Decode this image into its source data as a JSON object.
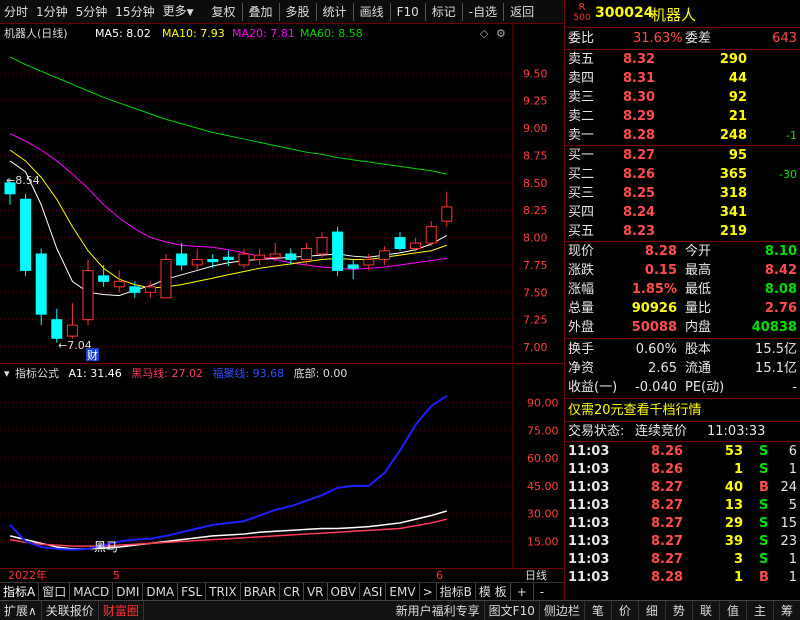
{
  "toolbar": {
    "left_items": [
      "分时",
      "1分钟",
      "5分钟",
      "15分钟",
      "更多"
    ],
    "right_items": [
      "复权",
      "叠加",
      "多股",
      "统计",
      "画线",
      "F10",
      "标记",
      "-自选",
      "返回"
    ]
  },
  "symbol": {
    "badge_top": "R",
    "badge_bottom": "500",
    "code": "300024",
    "name": "机器人"
  },
  "main_legend": {
    "title": "机器人(日线)",
    "ma5": "MA5: 8.02",
    "ma10": "MA10: 7.93",
    "ma20": "MA20: 7.81",
    "ma60": "MA60: 8.58",
    "high_label": "8.54",
    "low_label": "7.04",
    "marker": "财"
  },
  "ind_legend": {
    "name": "指标公式",
    "a1": "A1: 31.46",
    "heima": "黑马线: 27.02",
    "zhuli": "福聚线: 93.68",
    "dibu": "底部: 0.00",
    "curve_label": "黑马"
  },
  "colors": {
    "up": "#ff3232",
    "down": "#00ffff",
    "ma5": "#ffffff",
    "ma10": "#ffff00",
    "ma20": "#ff00ff",
    "ma60": "#00d400",
    "zhuli": "#1e1eff",
    "heima": "#ff3c5a"
  },
  "chart_data": [
    {
      "type": "candlestick",
      "title": "机器人(日线)",
      "ylim": [
        6.9,
        9.75
      ],
      "yticks": [
        "9.50",
        "9.25",
        "9.00",
        "8.75",
        "8.50",
        "8.25",
        "8.00",
        "7.75",
        "7.50",
        "7.25",
        "7.00"
      ],
      "candles": [
        [
          8.5,
          8.54,
          8.3,
          8.4
        ],
        [
          8.35,
          8.4,
          7.65,
          7.7
        ],
        [
          7.85,
          7.9,
          7.2,
          7.3
        ],
        [
          7.25,
          7.35,
          7.04,
          7.08
        ],
        [
          7.1,
          7.4,
          7.08,
          7.2
        ],
        [
          7.25,
          7.8,
          7.2,
          7.7
        ],
        [
          7.65,
          7.75,
          7.55,
          7.6
        ],
        [
          7.55,
          7.7,
          7.5,
          7.6
        ],
        [
          7.55,
          7.6,
          7.45,
          7.5
        ],
        [
          7.5,
          7.6,
          7.45,
          7.55
        ],
        [
          7.45,
          7.85,
          7.45,
          7.8
        ],
        [
          7.85,
          7.95,
          7.7,
          7.75
        ],
        [
          7.75,
          7.9,
          7.7,
          7.8
        ],
        [
          7.8,
          7.85,
          7.72,
          7.78
        ],
        [
          7.82,
          7.88,
          7.74,
          7.8
        ],
        [
          7.75,
          7.9,
          7.72,
          7.85
        ],
        [
          7.8,
          7.9,
          7.75,
          7.84
        ],
        [
          7.82,
          7.95,
          7.78,
          7.85
        ],
        [
          7.85,
          7.9,
          7.75,
          7.8
        ],
        [
          7.8,
          7.95,
          7.75,
          7.9
        ],
        [
          7.85,
          8.05,
          7.82,
          8.0
        ],
        [
          8.05,
          8.1,
          7.65,
          7.7
        ],
        [
          7.75,
          7.8,
          7.62,
          7.72
        ],
        [
          7.75,
          7.85,
          7.7,
          7.8
        ],
        [
          7.8,
          7.92,
          7.75,
          7.88
        ],
        [
          8.0,
          8.05,
          7.88,
          7.9
        ],
        [
          7.9,
          8.0,
          7.85,
          7.95
        ],
        [
          7.95,
          8.15,
          7.92,
          8.1
        ],
        [
          8.15,
          8.42,
          8.1,
          8.28
        ]
      ],
      "ma5": [
        8.7,
        8.6,
        8.3,
        7.9,
        7.6,
        7.5,
        7.48,
        7.47,
        7.52,
        7.56,
        7.62,
        7.66,
        7.7,
        7.74,
        7.77,
        7.79,
        7.8,
        7.81,
        7.82,
        7.83,
        7.84,
        7.85,
        7.83,
        7.82,
        7.84,
        7.86,
        7.89,
        7.94,
        8.02
      ],
      "ma10": [
        8.8,
        8.7,
        8.55,
        8.35,
        8.1,
        7.88,
        7.72,
        7.62,
        7.57,
        7.54,
        7.55,
        7.57,
        7.6,
        7.63,
        7.66,
        7.69,
        7.72,
        7.74,
        7.76,
        7.78,
        7.8,
        7.81,
        7.8,
        7.8,
        7.82,
        7.84,
        7.86,
        7.88,
        7.93
      ],
      "ma20": [
        8.95,
        8.88,
        8.8,
        8.7,
        8.58,
        8.45,
        8.3,
        8.18,
        8.08,
        8.0,
        7.96,
        7.93,
        7.92,
        7.91,
        7.89,
        7.86,
        7.83,
        7.8,
        7.77,
        7.75,
        7.73,
        7.72,
        7.71,
        7.72,
        7.73,
        7.75,
        7.77,
        7.79,
        7.81
      ],
      "ma60": [
        9.65,
        9.58,
        9.52,
        9.46,
        9.4,
        9.34,
        9.28,
        9.23,
        9.18,
        9.13,
        9.08,
        9.04,
        9.0,
        8.96,
        8.93,
        8.9,
        8.87,
        8.84,
        8.81,
        8.78,
        8.76,
        8.73,
        8.71,
        8.69,
        8.67,
        8.65,
        8.63,
        8.61,
        8.58
      ]
    },
    {
      "type": "line",
      "ylim": [
        5,
        100
      ],
      "yticks": [
        "90.00",
        "75.00",
        "60.00",
        "45.00",
        "30.00",
        "15.00"
      ],
      "series": [
        {
          "name": "A1",
          "values": [
            18,
            16,
            14,
            12,
            11,
            11,
            11.5,
            12,
            13,
            14,
            15,
            16,
            17,
            18,
            18.5,
            19,
            20,
            20.5,
            21,
            21.5,
            22,
            22,
            22.5,
            23,
            24,
            25,
            27,
            29,
            31.46
          ]
        },
        {
          "name": "黑马线",
          "values": [
            16,
            14.5,
            13.5,
            13,
            12.5,
            12.5,
            12.5,
            13,
            13.5,
            14,
            14.5,
            15,
            15.5,
            16,
            16.5,
            17,
            17.5,
            18,
            18.5,
            19,
            19.5,
            20,
            20.5,
            21,
            21.5,
            22,
            23.5,
            25,
            27.02
          ]
        },
        {
          "name": "福聚线",
          "values": [
            24,
            15,
            12,
            11,
            10.5,
            11,
            13,
            15,
            16,
            16.5,
            18,
            20,
            22,
            24,
            25,
            26,
            29,
            32,
            34,
            37,
            40,
            44,
            45,
            45,
            52,
            64,
            78,
            88,
            93.68
          ]
        }
      ]
    }
  ],
  "date_axis": {
    "start": "2022年",
    "m5": "5",
    "m6": "6",
    "right": "日线"
  },
  "tabs": [
    "指标A",
    "窗口",
    "MACD",
    "DMI",
    "DMA",
    "FSL",
    "TRIX",
    "BRAR",
    "CR",
    "VR",
    "OBV",
    "ASI",
    "EMV",
    ">",
    "指标B",
    "模 板",
    "+",
    "-"
  ],
  "bottom_left": [
    "扩展∧",
    "关联报价",
    "财富圈"
  ],
  "bottom_right_promo": "新用户福利专享",
  "bottom_right": [
    "图文F10",
    "侧边栏",
    "笔",
    "价",
    "细",
    "势",
    "联",
    "值",
    "主",
    "筹"
  ],
  "quote": {
    "weibi_label": "委比",
    "weibi": "31.63%",
    "weicha_label": "委差",
    "weicha": "643",
    "asks": [
      {
        "label": "卖五",
        "price": "8.32",
        "vol": "290",
        "chg": ""
      },
      {
        "label": "卖四",
        "price": "8.31",
        "vol": "44",
        "chg": ""
      },
      {
        "label": "卖三",
        "price": "8.30",
        "vol": "92",
        "chg": ""
      },
      {
        "label": "卖二",
        "price": "8.29",
        "vol": "21",
        "chg": ""
      },
      {
        "label": "卖一",
        "price": "8.28",
        "vol": "248",
        "chg": "-1"
      }
    ],
    "bids": [
      {
        "label": "买一",
        "price": "8.27",
        "vol": "95",
        "chg": ""
      },
      {
        "label": "买二",
        "price": "8.26",
        "vol": "365",
        "chg": "-30"
      },
      {
        "label": "买三",
        "price": "8.25",
        "vol": "318",
        "chg": ""
      },
      {
        "label": "买四",
        "price": "8.24",
        "vol": "341",
        "chg": ""
      },
      {
        "label": "买五",
        "price": "8.23",
        "vol": "219",
        "chg": ""
      }
    ],
    "stats": [
      {
        "l1": "现价",
        "v1": "8.28",
        "c1": "r",
        "l2": "今开",
        "v2": "8.10",
        "c2": "g"
      },
      {
        "l1": "涨跌",
        "v1": "0.15",
        "c1": "r",
        "l2": "最高",
        "v2": "8.42",
        "c2": "r"
      },
      {
        "l1": "涨幅",
        "v1": "1.85%",
        "c1": "r",
        "l2": "最低",
        "v2": "8.08",
        "c2": "g"
      },
      {
        "l1": "总量",
        "v1": "90926",
        "c1": "y",
        "l2": "量比",
        "v2": "2.76",
        "c2": "r"
      },
      {
        "l1": "外盘",
        "v1": "50088",
        "c1": "r",
        "l2": "内盘",
        "v2": "40838",
        "c2": "g"
      }
    ],
    "stats2": [
      {
        "l1": "换手",
        "v1": "0.60%",
        "l2": "股本",
        "v2": "15.5亿"
      },
      {
        "l1": "净资",
        "v1": "2.65",
        "l2": "流通",
        "v2": "15.1亿"
      },
      {
        "l1": "收益(一)",
        "v1": "-0.040",
        "l2": "PE(动)",
        "v2": "-"
      }
    ],
    "promo": "仅需20元查看千档行情",
    "status_label": "交易状态:",
    "status": "连续竞价",
    "status_time": "11:03:33",
    "ticks": [
      {
        "t": "11:03",
        "p": "8.26",
        "pc": "r",
        "v": "53",
        "s": "S",
        "sc": "g",
        "n": "6"
      },
      {
        "t": "11:03",
        "p": "8.26",
        "pc": "r",
        "v": "1",
        "s": "S",
        "sc": "g",
        "n": "1"
      },
      {
        "t": "11:03",
        "p": "8.27",
        "pc": "r",
        "v": "40",
        "s": "B",
        "sc": "r",
        "n": "24"
      },
      {
        "t": "11:03",
        "p": "8.27",
        "pc": "r",
        "v": "13",
        "s": "S",
        "sc": "g",
        "n": "5"
      },
      {
        "t": "11:03",
        "p": "8.27",
        "pc": "r",
        "v": "29",
        "s": "S",
        "sc": "g",
        "n": "15"
      },
      {
        "t": "11:03",
        "p": "8.27",
        "pc": "r",
        "v": "39",
        "s": "S",
        "sc": "g",
        "n": "23"
      },
      {
        "t": "11:03",
        "p": "8.27",
        "pc": "r",
        "v": "3",
        "s": "S",
        "sc": "g",
        "n": "1"
      },
      {
        "t": "11:03",
        "p": "8.28",
        "pc": "r",
        "v": "1",
        "s": "B",
        "sc": "r",
        "n": "1"
      }
    ]
  }
}
